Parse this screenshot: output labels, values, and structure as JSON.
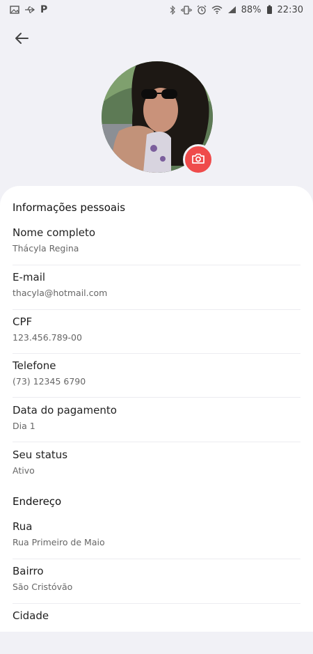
{
  "status_bar": {
    "left_icons": [
      "image-icon",
      "usb-icon",
      "parking-icon"
    ],
    "parking_text": "P",
    "right_icons": [
      "bluetooth-icon",
      "vibrate-icon",
      "alarm-icon",
      "wifi-icon",
      "signal-icon",
      "battery-icon"
    ],
    "battery_percent": "88%",
    "time": "22:30"
  },
  "header": {
    "back_icon": "arrow-left-icon"
  },
  "profile": {
    "camera_icon": "camera-icon",
    "accent_color": "#ef4b4b"
  },
  "personal": {
    "title": "Informações pessoais",
    "fields": [
      {
        "label": "Nome completo",
        "value": "Thácyla Regina"
      },
      {
        "label": "E-mail",
        "value": "thacyla@hotmail.com"
      },
      {
        "label": "CPF",
        "value": "123.456.789-00"
      },
      {
        "label": "Telefone",
        "value": "(73) 12345 6790"
      },
      {
        "label": "Data do pagamento",
        "value": "Dia 1"
      },
      {
        "label": "Seu status",
        "value": "Ativo"
      }
    ]
  },
  "address": {
    "title": "Endereço",
    "fields": [
      {
        "label": "Rua",
        "value": "Rua Primeiro de Maio"
      },
      {
        "label": "Bairro",
        "value": "São Cristóvão"
      },
      {
        "label": "Cidade",
        "value": ""
      }
    ]
  }
}
